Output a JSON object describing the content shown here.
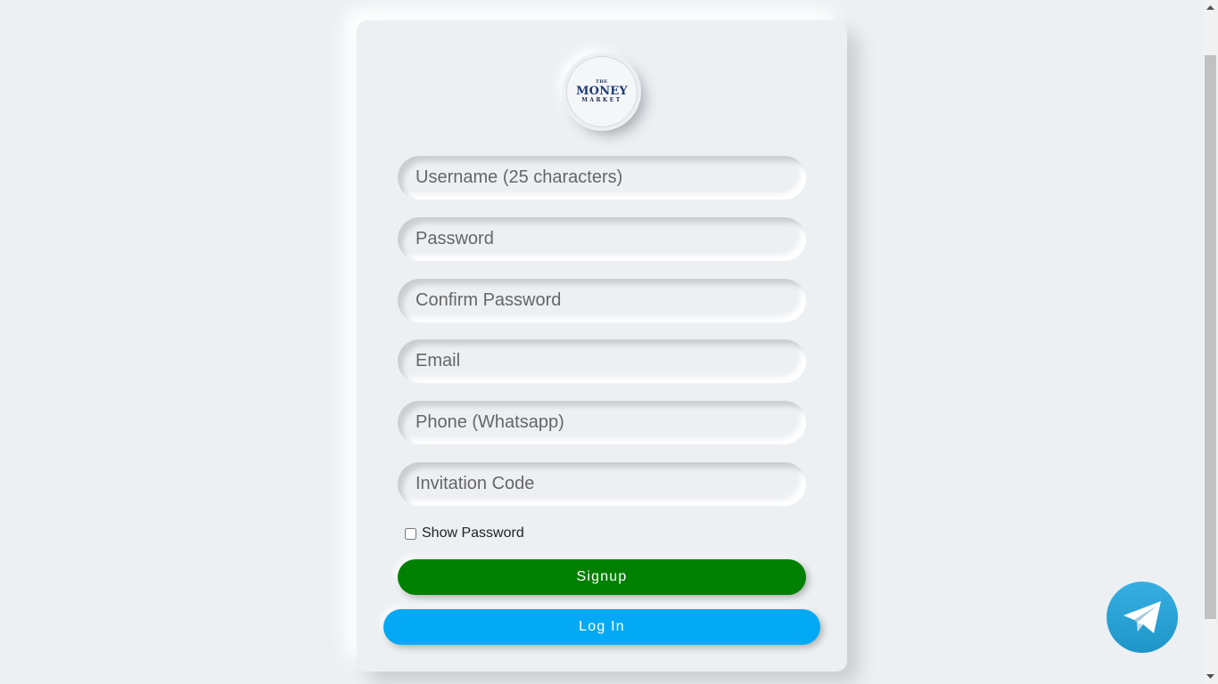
{
  "logo": {
    "line1": "THE",
    "line2": "MONEY",
    "line3": "MARKET"
  },
  "form": {
    "username_placeholder": "Username (25 characters)",
    "password_placeholder": "Password",
    "confirm_password_placeholder": "Confirm Password",
    "email_placeholder": "Email",
    "phone_placeholder": "Phone (Whatsapp)",
    "invitation_placeholder": "Invitation Code",
    "show_password_label": "Show Password",
    "show_password_checked": false
  },
  "buttons": {
    "signup_label": "Signup",
    "login_label": "Log In"
  },
  "telegram": {
    "icon": "telegram-icon"
  },
  "colors": {
    "background": "#ecf0f3",
    "signup": "#008000",
    "login": "#03a9f4",
    "telegram": "#2ca5e0"
  }
}
